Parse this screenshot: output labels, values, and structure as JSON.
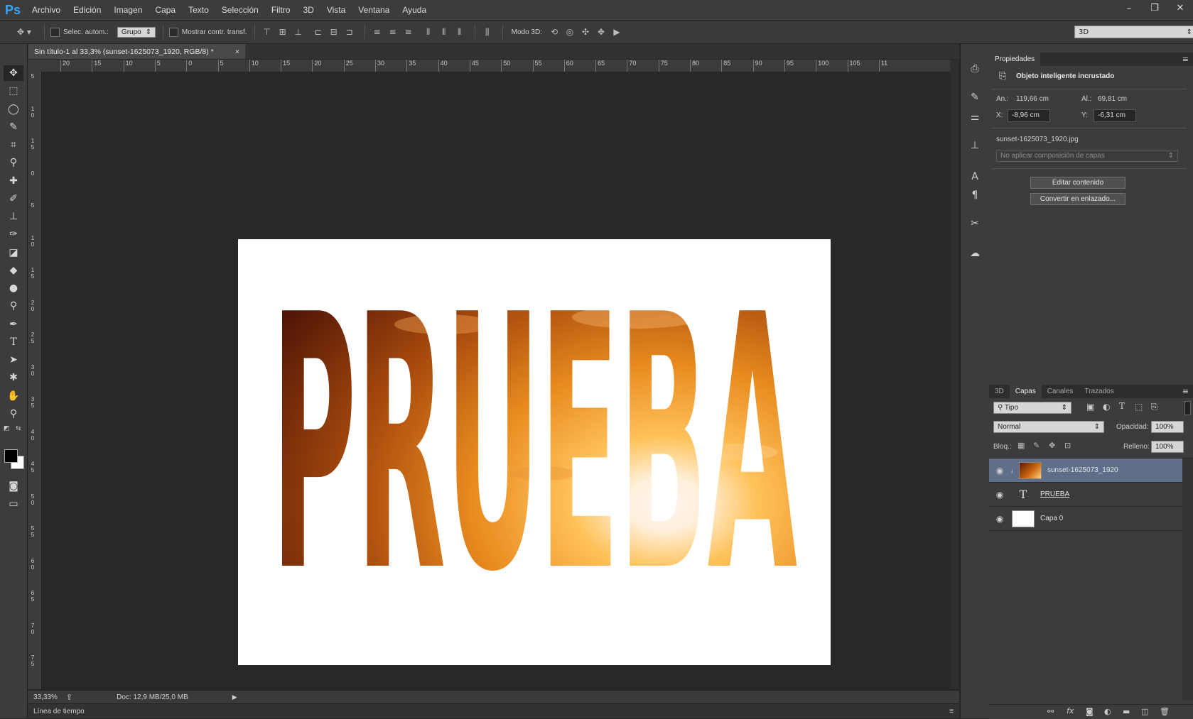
{
  "app": {
    "logo": "Ps"
  },
  "menu": [
    "Archivo",
    "Edición",
    "Imagen",
    "Capa",
    "Texto",
    "Selección",
    "Filtro",
    "3D",
    "Vista",
    "Ventana",
    "Ayuda"
  ],
  "window_controls": {
    "minimize": "–",
    "restore": "❐",
    "close": "✕"
  },
  "options": {
    "auto_select_label": "Selec. autom.:",
    "auto_select_value": "Grupo",
    "show_transform_label": "Mostrar contr. transf.",
    "mode3d_label": "Modo 3D:",
    "workspace_value": "3D"
  },
  "document": {
    "tab_title": "Sin título-1 al 33,3% (sunset-1625073_1920, RGB/8) *",
    "close_glyph": "×"
  },
  "ruler": {
    "top_labels": [
      "20",
      "15",
      "10",
      "5",
      "0",
      "5",
      "10",
      "15",
      "20",
      "25",
      "30",
      "35",
      "40",
      "45",
      "50",
      "55",
      "60",
      "65",
      "70",
      "75",
      "80",
      "85",
      "90",
      "95",
      "100",
      "105",
      "11"
    ],
    "left_labels": [
      "5",
      "1 0",
      "1 5",
      "0",
      "5",
      "1 0",
      "1 5",
      "2 0",
      "2 5",
      "3 0",
      "3 5",
      "4 0",
      "4 5",
      "5 0",
      "5 5",
      "6 0",
      "6 5",
      "7 0",
      "7 5"
    ]
  },
  "canvas": {
    "text": "PRUEBA"
  },
  "status": {
    "zoom": "33,33%",
    "doc_info": "Doc: 12,9 MB/25,0 MB"
  },
  "timeline": {
    "label": "Línea de tiempo"
  },
  "properties": {
    "tab": "Propiedades",
    "heading": "Objeto inteligente incrustado",
    "width_label": "An.:",
    "width_value": "119,66 cm",
    "height_label": "Al.:",
    "height_value": "69,81 cm",
    "x_label": "X:",
    "x_value": "-8,96 cm",
    "y_label": "Y:",
    "y_value": "-6,31 cm",
    "filename": "sunset-1625073_1920.jpg",
    "comp_select": "No aplicar composición de capas",
    "edit_button": "Editar contenido",
    "convert_button": "Convertir en enlazado..."
  },
  "layers_panel": {
    "tabs": [
      "3D",
      "Capas",
      "Canales",
      "Trazados"
    ],
    "active_tab": "Capas",
    "filter_value": "Tipo",
    "blend_mode": "Normal",
    "opacity_label": "Opacidad:",
    "opacity_value": "100%",
    "lock_label": "Bloq.:",
    "fill_label": "Relleno:",
    "fill_value": "100%",
    "layers": [
      {
        "name": "sunset-1625073_1920",
        "selected": true
      },
      {
        "name": "PRUEBA",
        "selected": false
      },
      {
        "name": "Capa 0",
        "selected": false
      }
    ]
  },
  "colors": {
    "accent_blue": "#31a8ff",
    "selected_layer": "#5f6f8a",
    "sunset_dark": "#5a1a05",
    "sunset_mid": "#c8650f",
    "sunset_light": "#ffd27a"
  }
}
